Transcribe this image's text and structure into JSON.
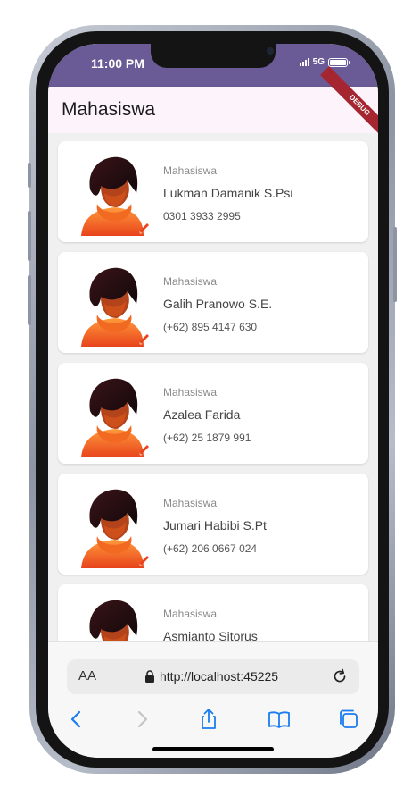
{
  "status_bar": {
    "time": "11:00 PM",
    "network": "5G"
  },
  "app_bar": {
    "title": "Mahasiswa",
    "debug_label": "DEBUG"
  },
  "list": {
    "items": [
      {
        "role": "Mahasiswa",
        "name": "Lukman Damanik S.Psi",
        "phone": "0301 3933 2995"
      },
      {
        "role": "Mahasiswa",
        "name": "Galih Pranowo S.E.",
        "phone": "(+62) 895 4147 630"
      },
      {
        "role": "Mahasiswa",
        "name": "Azalea Farida",
        "phone": "(+62) 25 1879 991"
      },
      {
        "role": "Mahasiswa",
        "name": "Jumari Habibi S.Pt",
        "phone": "(+62) 206 0667 024"
      },
      {
        "role": "Mahasiswa",
        "name": "Asmianto Sitorus",
        "phone": ""
      }
    ]
  },
  "browser": {
    "text_size_label": "AA",
    "url": "http://localhost:45225"
  },
  "colors": {
    "status_bar": "#6a5a95",
    "app_bar": "#fcf3fb",
    "accent": "#1a7cf0",
    "debug": "#a52631"
  }
}
